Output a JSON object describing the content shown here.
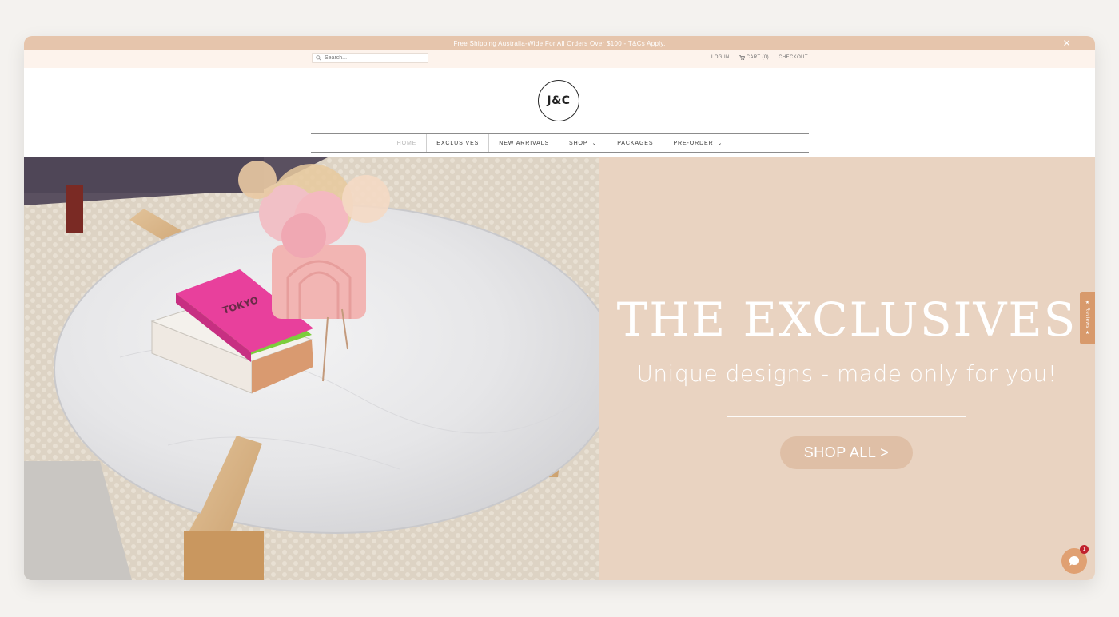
{
  "announcement": {
    "text": "Free Shipping Australia-Wide For All Orders Over $100 - T&Cs Apply.",
    "close_icon": "close-icon"
  },
  "utility": {
    "search_placeholder": "Search...",
    "login": "LOG IN",
    "cart": "CART (0)",
    "checkout": "CHECKOUT"
  },
  "brand": {
    "logo_text": "J&C"
  },
  "nav": {
    "items": [
      {
        "label": "HOME"
      },
      {
        "label": "EXCLUSIVES"
      },
      {
        "label": "NEW ARRIVALS"
      },
      {
        "label": "SHOP"
      },
      {
        "label": "PACKAGES"
      },
      {
        "label": "PRE-ORDER"
      }
    ]
  },
  "hero": {
    "title": "THE EXCLUSIVES",
    "subtitle": "Unique designs - made only for you!",
    "cta": "SHOP ALL >",
    "book_title": "TOKYO"
  },
  "widgets": {
    "reviews_label": "★ Reviews ★",
    "chat_badge": "1"
  },
  "colors": {
    "announcement_bg": "#e6c5ac",
    "utility_bg": "#fdf3ec",
    "hero_panel": "#e9d3c1",
    "cta_bg": "#dfbfa6",
    "accent": "#e0a072"
  }
}
